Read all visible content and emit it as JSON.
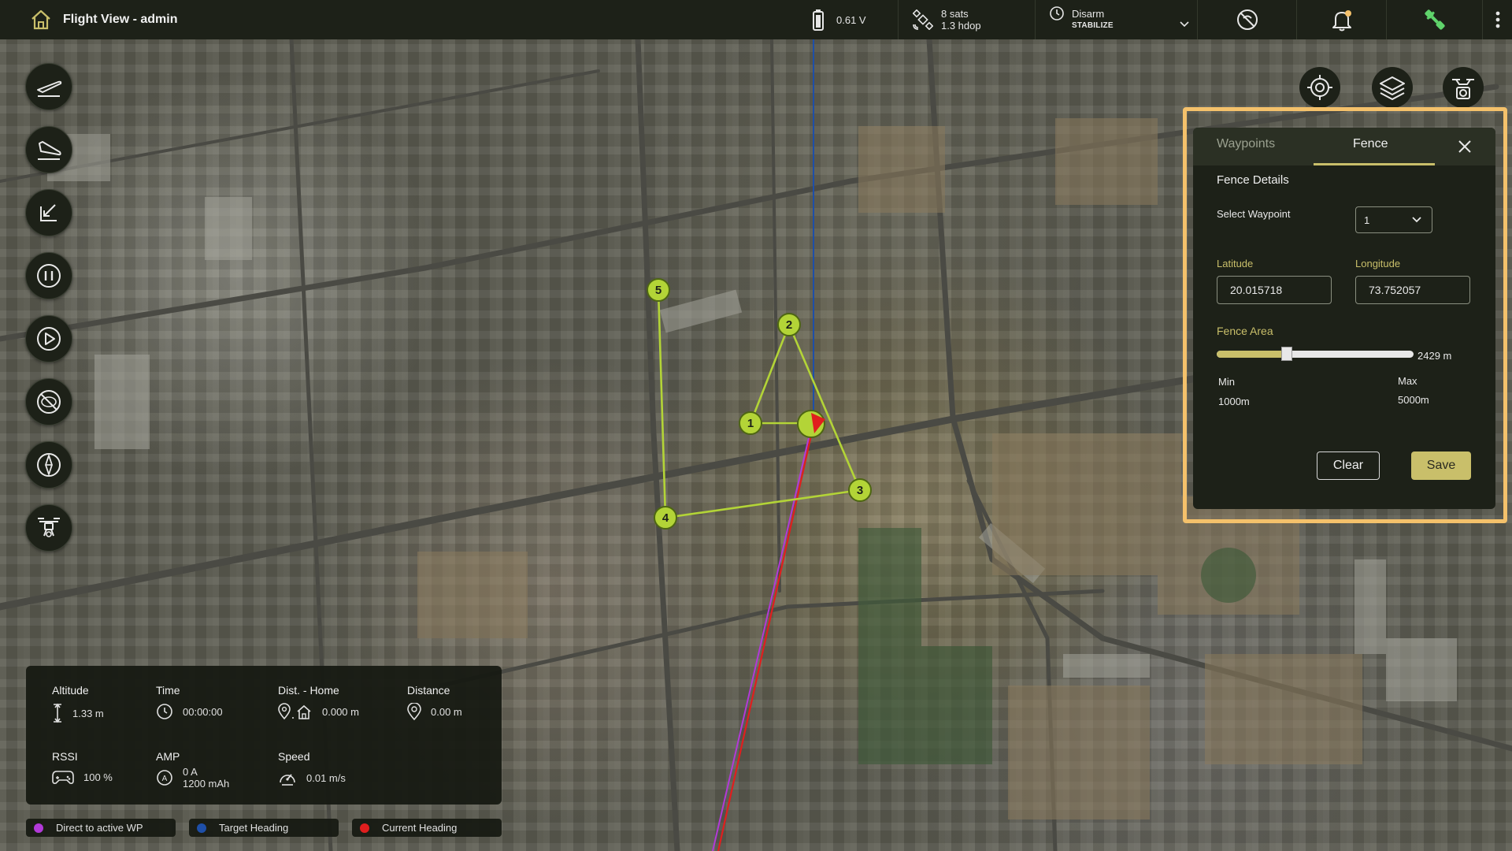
{
  "app": {
    "title": "Flight View - admin"
  },
  "topbar": {
    "battery_voltage": "0.61 V",
    "gps_sats": "8 sats",
    "gps_hdop": "1.3 hdop",
    "arm_state": "Disarm",
    "flight_mode": "STABILIZE"
  },
  "left_tools": [
    {
      "name": "takeoff-icon"
    },
    {
      "name": "land-icon"
    },
    {
      "name": "return-to-launch-icon"
    },
    {
      "name": "pause-icon"
    },
    {
      "name": "play-icon"
    },
    {
      "name": "no-fly-icon"
    },
    {
      "name": "compass-icon"
    },
    {
      "name": "drone-icon"
    }
  ],
  "right_tools": [
    {
      "name": "target-icon"
    },
    {
      "name": "layers-icon"
    },
    {
      "name": "drone-camera-icon"
    }
  ],
  "fence_panel": {
    "tab_waypoints": "Waypoints",
    "tab_fence": "Fence",
    "active_tab": "Fence",
    "heading": "Fence Details",
    "select_waypoint_label": "Select Waypoint",
    "select_waypoint_value": "1",
    "latitude_label": "Latitude",
    "latitude_value": "20.015718",
    "longitude_label": "Longitude",
    "longitude_value": "73.752057",
    "fence_area_label": "Fence Area",
    "fence_area_value": "2429 m",
    "fence_area_fraction": 0.3573,
    "min_label": "Min",
    "min_value": "1000m",
    "max_label": "Max",
    "max_value": "5000m",
    "clear_label": "Clear",
    "save_label": "Save"
  },
  "waypoints": [
    {
      "label": "1"
    },
    {
      "label": "2"
    },
    {
      "label": "3"
    },
    {
      "label": "4"
    },
    {
      "label": "5"
    }
  ],
  "telemetry": {
    "altitude_label": "Altitude",
    "altitude_value": "1.33 m",
    "time_label": "Time",
    "time_value": "00:00:00",
    "dist_home_label": "Dist. - Home",
    "dist_home_value": "0.000 m",
    "distance_label": "Distance",
    "distance_value": "0.00 m",
    "rssi_label": "RSSI",
    "rssi_value": "100 %",
    "amp_label": "AMP",
    "amp_current": "0 A",
    "amp_capacity": "1200 mAh",
    "speed_label": "Speed",
    "speed_value": "0.01 m/s"
  },
  "legend": {
    "direct_wp": "Direct to active WP",
    "target_heading": "Target Heading",
    "current_heading": "Current Heading",
    "colors": {
      "direct_wp": "#b23ad8",
      "target_heading": "#1e4fa8",
      "current_heading": "#e01e1e"
    }
  },
  "colors": {
    "accent": "#c9bf6a",
    "highlight": "#f4c16b",
    "panel_bg": "#1d2118",
    "connect": "#5fd36b"
  }
}
